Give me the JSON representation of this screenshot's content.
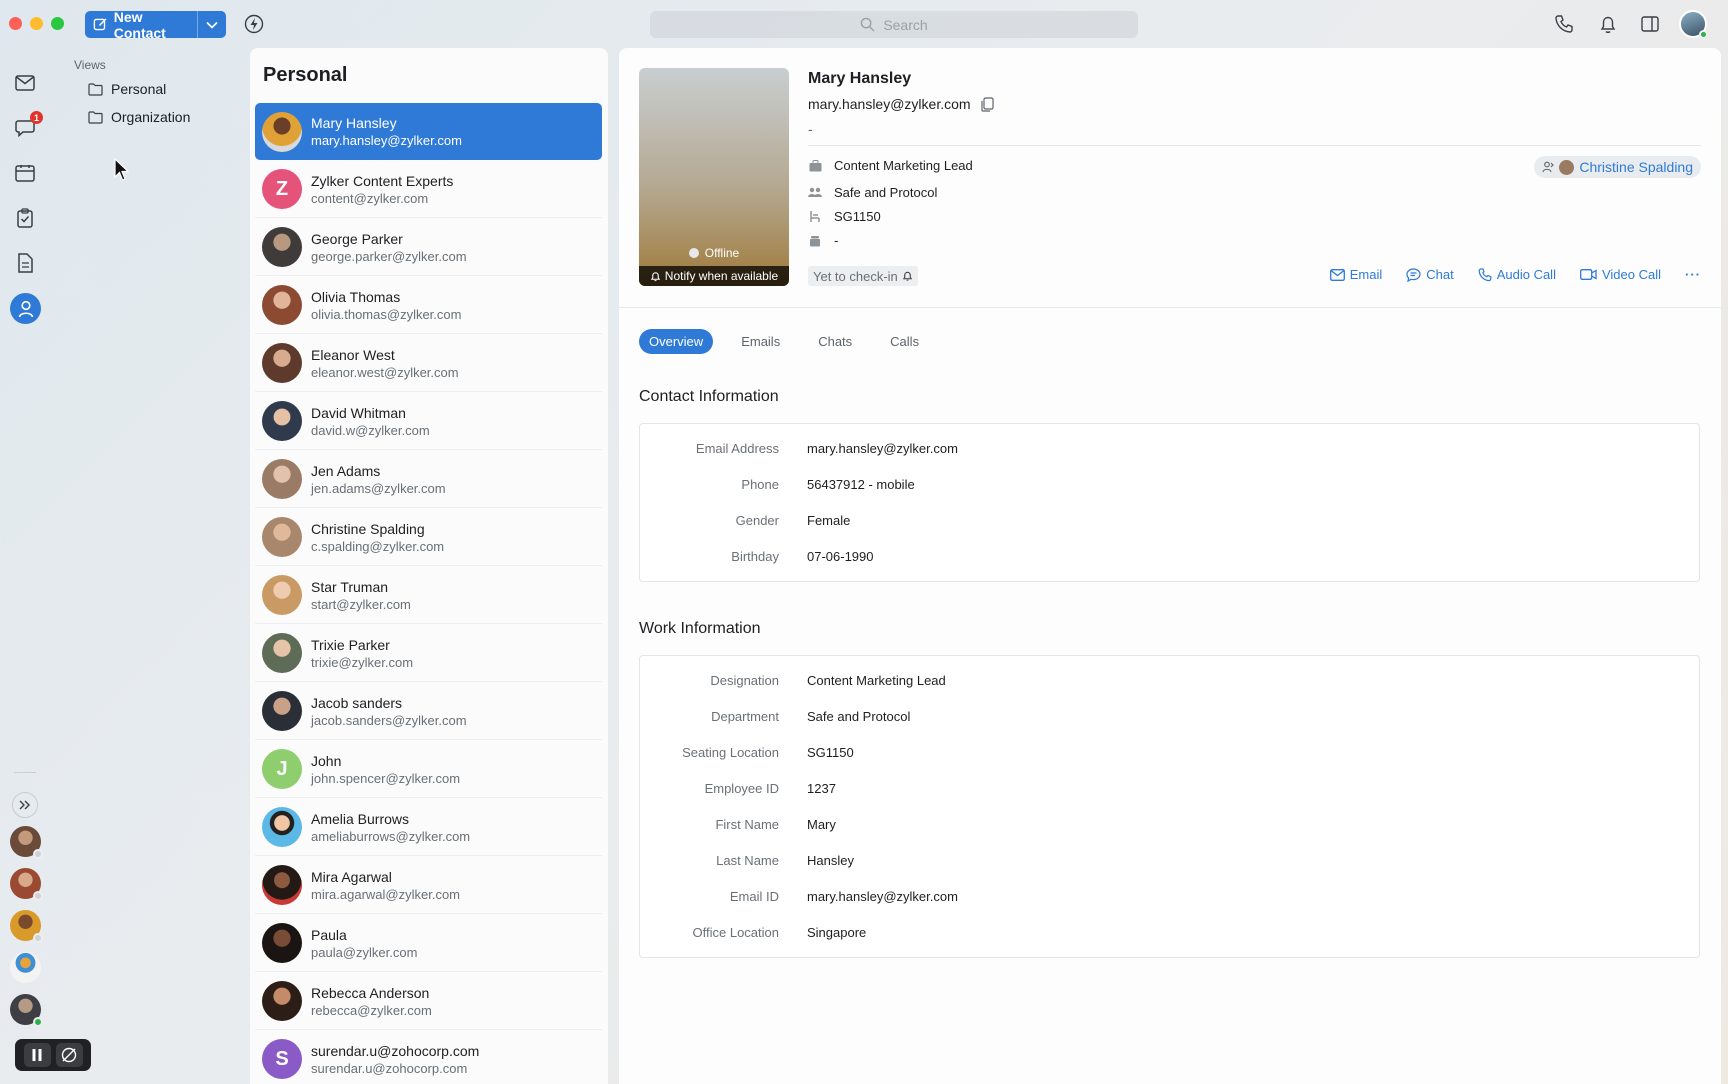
{
  "toolbar": {
    "new_contact_label": "New Contact",
    "search_placeholder": "Search"
  },
  "rail": {
    "chat_badge": "1"
  },
  "views": {
    "label": "Views",
    "items": [
      {
        "label": "Personal"
      },
      {
        "label": "Organization"
      }
    ]
  },
  "list": {
    "title": "Personal",
    "contacts": [
      {
        "name": "Mary Hansley",
        "email": "mary.hansley@zylker.com"
      },
      {
        "name": "Zylker Content Experts",
        "email": "content@zylker.com",
        "initial": "Z"
      },
      {
        "name": "George Parker",
        "email": "george.parker@zylker.com"
      },
      {
        "name": "Olivia Thomas",
        "email": "olivia.thomas@zylker.com"
      },
      {
        "name": "Eleanor West",
        "email": "eleanor.west@zylker.com"
      },
      {
        "name": "David Whitman",
        "email": "david.w@zylker.com"
      },
      {
        "name": "Jen Adams",
        "email": "jen.adams@zylker.com"
      },
      {
        "name": "Christine Spalding",
        "email": "c.spalding@zylker.com"
      },
      {
        "name": "Star Truman",
        "email": "start@zylker.com"
      },
      {
        "name": "Trixie Parker",
        "email": "trixie@zylker.com"
      },
      {
        "name": "Jacob sanders",
        "email": "jacob.sanders@zylker.com"
      },
      {
        "name": "John",
        "email": "john.spencer@zylker.com",
        "initial": "J"
      },
      {
        "name": "Amelia Burrows",
        "email": "ameliaburrows@zylker.com"
      },
      {
        "name": "Mira Agarwal",
        "email": "mira.agarwal@zylker.com"
      },
      {
        "name": "Paula",
        "email": "paula@zylker.com"
      },
      {
        "name": "Rebecca Anderson",
        "email": "rebecca@zylker.com"
      },
      {
        "name": "surendar.u@zohocorp.com",
        "email": "surendar.u@zohocorp.com",
        "initial": "S"
      }
    ]
  },
  "detail": {
    "name": "Mary Hansley",
    "email": "mary.hansley@zylker.com",
    "subtitle": "-",
    "status": "Offline",
    "notify_label": "Notify when available",
    "designation": "Content Marketing Lead",
    "department": "Safe and Protocol",
    "seating": "SG1150",
    "extra": "-",
    "reports_to": "Christine Spalding",
    "checkin": "Yet to check-in",
    "actions": {
      "email": "Email",
      "chat": "Chat",
      "audio_call": "Audio Call",
      "video_call": "Video Call",
      "more": "···"
    },
    "tabs": [
      "Overview",
      "Emails",
      "Chats",
      "Calls"
    ],
    "contact_info": {
      "title": "Contact Information",
      "rows": [
        {
          "label": "Email Address",
          "value": "mary.hansley@zylker.com"
        },
        {
          "label": "Phone",
          "value": "56437912 - mobile"
        },
        {
          "label": "Gender",
          "value": "Female"
        },
        {
          "label": "Birthday",
          "value": "07-06-1990"
        }
      ]
    },
    "work_info": {
      "title": "Work Information",
      "rows": [
        {
          "label": "Designation",
          "value": "Content Marketing Lead"
        },
        {
          "label": "Department",
          "value": "Safe and Protocol"
        },
        {
          "label": "Seating Location",
          "value": "SG1150"
        },
        {
          "label": "Employee ID",
          "value": "1237"
        },
        {
          "label": "First Name",
          "value": "Mary"
        },
        {
          "label": "Last Name",
          "value": "Hansley"
        },
        {
          "label": "Email ID",
          "value": "mary.hansley@zylker.com"
        },
        {
          "label": "Office Location",
          "value": "Singapore"
        }
      ]
    }
  },
  "colors": {
    "accent": "#2f7ad6",
    "badge": "#e0352b",
    "online": "#2bb24c"
  }
}
